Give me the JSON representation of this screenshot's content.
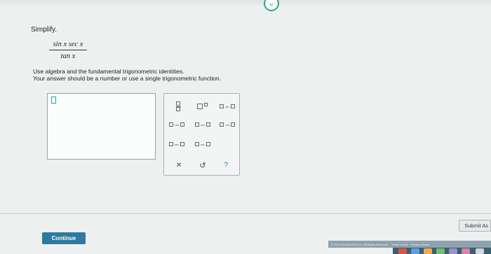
{
  "question": {
    "title": "Simplify.",
    "numerator": "sin x sec x",
    "denominator": "tan x",
    "instruction1": "Use algebra and the fundamental trigonometric identities.",
    "instruction2": "Your answer should be a number or use a single trigonometric function."
  },
  "palette": {
    "row2": [
      "cos",
      "tan",
      "cot"
    ],
    "row1_fn": "sin",
    "row3": [
      "sec",
      "csc"
    ],
    "clear": "✕",
    "undo": "↺",
    "help": "?"
  },
  "buttons": {
    "continue": "Continue",
    "submit": "Submit As"
  },
  "footer": {
    "copyright": "© 2022 McGraw Hill LLC. All Rights Reserved.",
    "terms": "Terms of Use",
    "privacy": "Privacy Center"
  },
  "colors": {
    "accent": "#2e7a9e",
    "teal": "#2aa58a"
  }
}
